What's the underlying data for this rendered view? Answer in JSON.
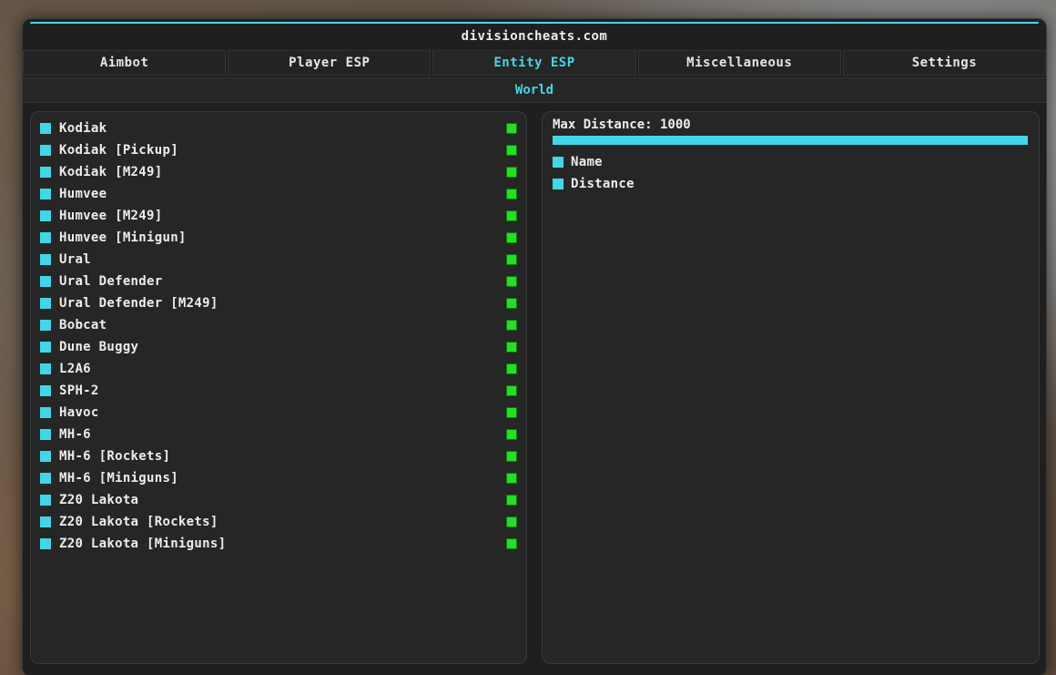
{
  "window": {
    "title": "divisioncheats.com",
    "accent_color": "#3fd8e8"
  },
  "tabs": [
    {
      "label": "Aimbot"
    },
    {
      "label": "Player ESP"
    },
    {
      "label": "Entity ESP",
      "active": true
    },
    {
      "label": "Miscellaneous"
    },
    {
      "label": "Settings"
    }
  ],
  "section": {
    "title": "World"
  },
  "entities": [
    {
      "label": "Kodiak",
      "checked": true,
      "color": "#22e022"
    },
    {
      "label": "Kodiak [Pickup]",
      "checked": true,
      "color": "#22e022"
    },
    {
      "label": "Kodiak [M249]",
      "checked": true,
      "color": "#22e022"
    },
    {
      "label": "Humvee",
      "checked": true,
      "color": "#22e022"
    },
    {
      "label": "Humvee [M249]",
      "checked": true,
      "color": "#22e022"
    },
    {
      "label": "Humvee [Minigun]",
      "checked": true,
      "color": "#22e022"
    },
    {
      "label": "Ural",
      "checked": true,
      "color": "#22e022"
    },
    {
      "label": "Ural Defender",
      "checked": true,
      "color": "#22e022"
    },
    {
      "label": "Ural Defender [M249]",
      "checked": true,
      "color": "#22e022"
    },
    {
      "label": "Bobcat",
      "checked": true,
      "color": "#22e022"
    },
    {
      "label": "Dune Buggy",
      "checked": true,
      "color": "#22e022"
    },
    {
      "label": "L2A6",
      "checked": true,
      "color": "#22e022"
    },
    {
      "label": "SPH-2",
      "checked": true,
      "color": "#22e022"
    },
    {
      "label": "Havoc",
      "checked": true,
      "color": "#22e022"
    },
    {
      "label": "MH-6",
      "checked": true,
      "color": "#22e022"
    },
    {
      "label": "MH-6 [Rockets]",
      "checked": true,
      "color": "#22e022"
    },
    {
      "label": "MH-6 [Miniguns]",
      "checked": true,
      "color": "#22e022"
    },
    {
      "label": "Z20 Lakota",
      "checked": true,
      "color": "#22e022"
    },
    {
      "label": "Z20 Lakota [Rockets]",
      "checked": true,
      "color": "#22e022"
    },
    {
      "label": "Z20 Lakota [Miniguns]",
      "checked": true,
      "color": "#22e022"
    }
  ],
  "settings": {
    "max_distance": {
      "label": "Max Distance: 1000",
      "value": 1000,
      "fill_fraction": 1.0
    },
    "options": [
      {
        "label": "Name",
        "checked": true
      },
      {
        "label": "Distance",
        "checked": true
      }
    ]
  }
}
